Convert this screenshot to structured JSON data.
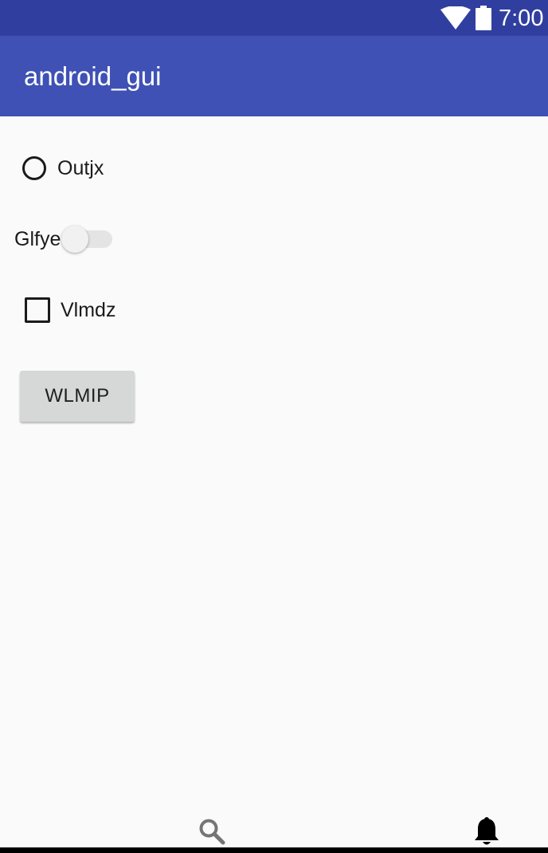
{
  "status_bar": {
    "time": "7:00",
    "icons": [
      "wifi-icon",
      "battery-icon"
    ],
    "color": "#303f9f"
  },
  "app_bar": {
    "title": "android_gui",
    "color": "#3f51b5"
  },
  "content": {
    "radio": {
      "label": "Outjx",
      "checked": false
    },
    "switch": {
      "label": "Glfye",
      "on": false
    },
    "checkbox": {
      "label": "Vlmdz",
      "checked": false
    },
    "button": {
      "label": "WLMIP"
    }
  },
  "bottom_nav": {
    "icons": [
      "search-icon",
      "bell-icon"
    ]
  }
}
